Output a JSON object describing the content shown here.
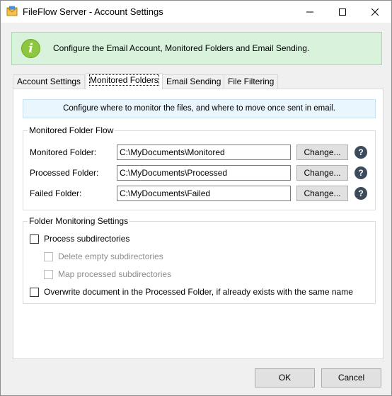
{
  "window": {
    "title": "FileFlow Server - Account Settings"
  },
  "banner": {
    "text": "Configure the Email Account, Monitored Folders and Email Sending."
  },
  "tabs": [
    {
      "label": "Account Settings",
      "active": false
    },
    {
      "label": "Monitored Folders",
      "active": true
    },
    {
      "label": "Email Sending",
      "active": false
    },
    {
      "label": "File Filtering",
      "active": false
    }
  ],
  "hint": "Configure where to monitor the files, and where to move once sent in email.",
  "folder_flow": {
    "title": "Monitored Folder Flow",
    "rows": [
      {
        "label": "Monitored Folder:",
        "value": "C:\\MyDocuments\\Monitored",
        "button": "Change...",
        "help": "?"
      },
      {
        "label": "Processed Folder:",
        "value": "C:\\MyDocuments\\Processed",
        "button": "Change...",
        "help": "?"
      },
      {
        "label": "Failed Folder:",
        "value": "C:\\MyDocuments\\Failed",
        "button": "Change...",
        "help": "?"
      }
    ]
  },
  "monitoring_settings": {
    "title": "Folder Monitoring Settings",
    "options": [
      {
        "label": "Process subdirectories",
        "checked": false,
        "enabled": true
      },
      {
        "label": "Delete empty subdirectories",
        "checked": false,
        "enabled": false
      },
      {
        "label": "Map processed subdirectories",
        "checked": false,
        "enabled": false
      },
      {
        "label": "Overwrite document in the Processed Folder, if already exists with the same name",
        "checked": false,
        "enabled": true
      }
    ]
  },
  "buttons": {
    "ok": "OK",
    "cancel": "Cancel"
  },
  "icons": {
    "app": "envelope-icon",
    "info": "info-icon",
    "help": "question-icon"
  },
  "colors": {
    "banner_bg": "#d9f2dc",
    "info_icon": "#8dc63f",
    "hint_bg": "#eaf6fd",
    "help_icon": "#3d4a5c"
  }
}
